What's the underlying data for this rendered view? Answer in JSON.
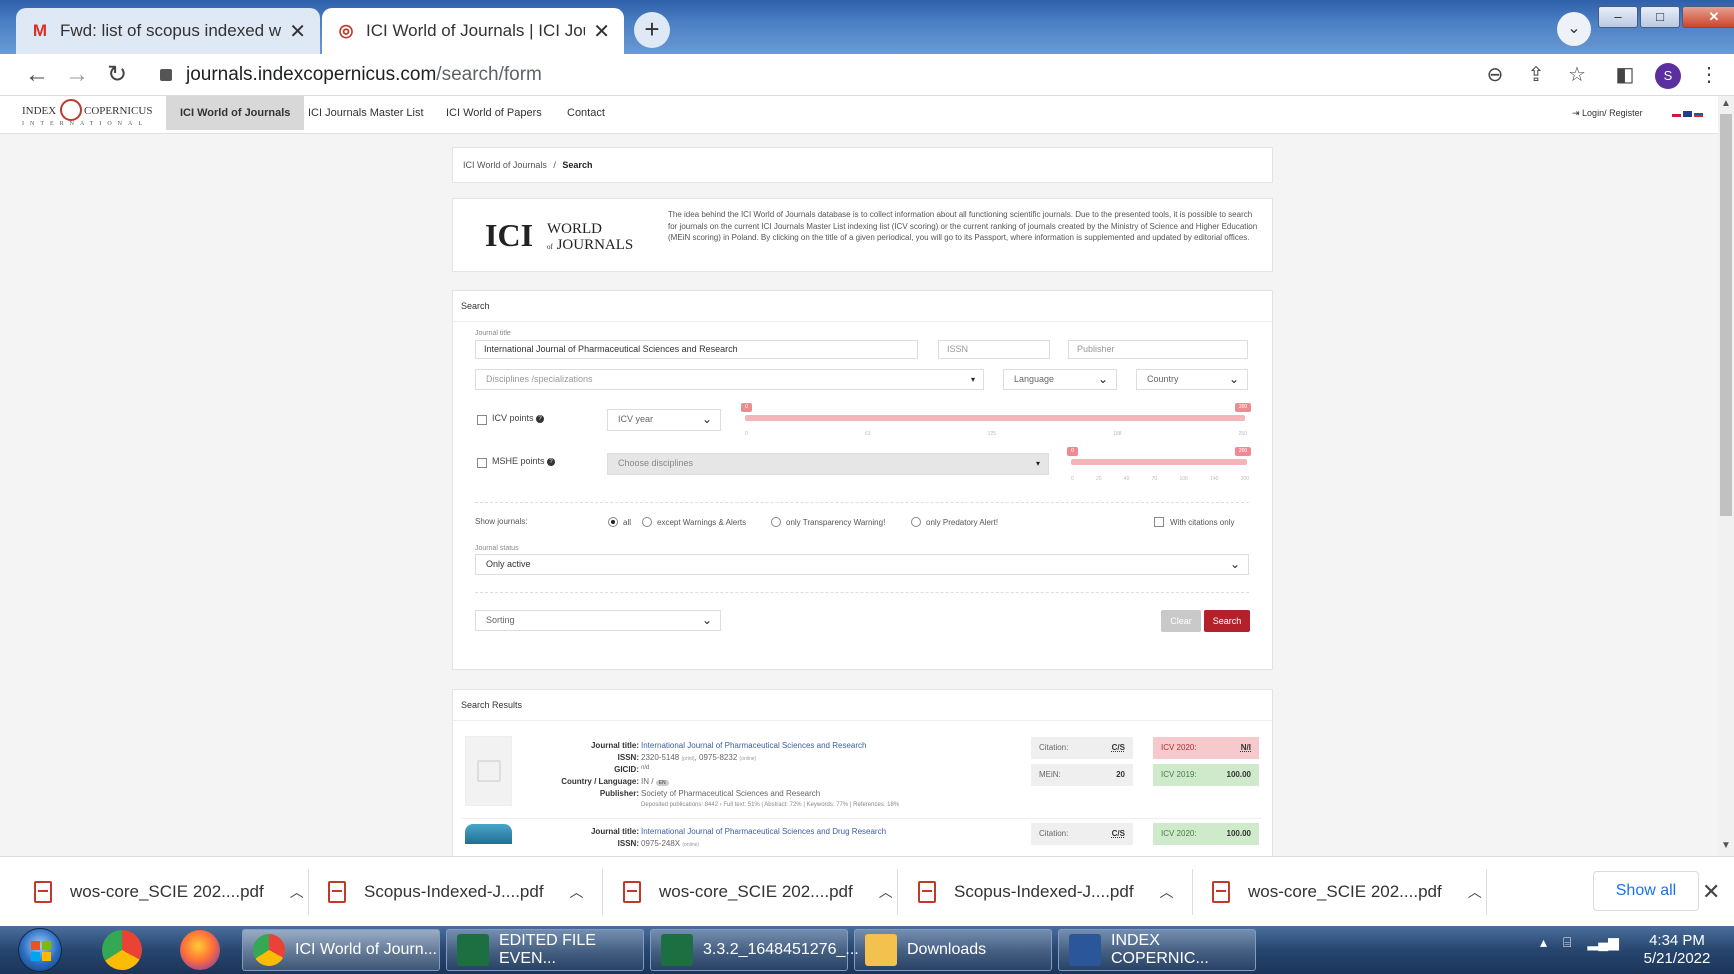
{
  "browser": {
    "tabs": [
      {
        "title": "Fwd: list of scopus indexed wos a",
        "icon": "gmail-icon",
        "active": false
      },
      {
        "title": "ICI World of Journals | ICI Journal",
        "icon": "index-copernicus-icon",
        "active": true
      }
    ],
    "url_host": "journals.indexcopernicus.com",
    "url_path": "/search/form",
    "profile_initial": "S"
  },
  "site": {
    "logo_text_left": "INDEX",
    "logo_text_right": "COPERNICUS",
    "logo_sub": "INTERNATIONAL",
    "nav": [
      "ICI World of Journals",
      "ICI Journals Master List",
      "ICI World of Papers",
      "Contact"
    ],
    "login": "Login/ Register"
  },
  "breadcrumb": {
    "parent": "ICI World of Journals",
    "separator": "/",
    "current": "Search"
  },
  "intro": {
    "logo_ici": "ICI",
    "logo_world": "WORLD",
    "logo_of": "of",
    "logo_journals": "JOURNALS",
    "text": "The idea behind the ICI World of Journals database is to collect information about all functioning scientific journals. Due to the presented tools, it is possible to search for journals on the current ICI Journals Master List indexing list (ICV scoring) or the current ranking of journals created by the Ministry of Science and Higher Education (MEiN scoring) in Poland. By clicking on the title of a given periodical, you will go to its Passport, where information is supplemented and updated by editorial offices."
  },
  "search": {
    "section_title": "Search",
    "journal_title_label": "Journal title",
    "journal_title_value": "International Journal of Pharmaceutical Sciences and Research",
    "issn_placeholder": "ISSN",
    "publisher_placeholder": "Publisher",
    "disciplines_placeholder": "Disciplines /specializations",
    "language_label": "Language",
    "country_label": "Country",
    "icv_points_label": "ICV points",
    "icv_year_label": "ICV year",
    "icv_min": "0",
    "icv_max": "200",
    "icv_ticks": [
      "0",
      "63",
      "125",
      "188",
      "250"
    ],
    "mshe_points_label": "MSHE points",
    "choose_disciplines_placeholder": "Choose disciplines",
    "mshe_min": "0",
    "mshe_max": "200",
    "mshe_ticks": [
      "0",
      "20",
      "40",
      "70",
      "100",
      "140",
      "200"
    ],
    "show_journals_label": "Show journals:",
    "radio_options": [
      "all",
      "except Warnings & Alerts",
      "only Transparency Warning!",
      "only Predatory Alert!"
    ],
    "with_citations_label": "With citations only",
    "journal_status_label": "Journal status",
    "journal_status_value": "Only active",
    "sorting_label": "Sorting",
    "clear_label": "Clear",
    "search_label": "Search"
  },
  "results": {
    "section_title": "Search Results",
    "keys": {
      "title": "Journal title:",
      "issn": "ISSN:",
      "gicid": "GICID:",
      "country_lang": "Country / Language:",
      "publisher": "Publisher:"
    },
    "items": [
      {
        "title": "International Journal of Pharmaceutical Sciences and Research",
        "issn_print": "2320-5148",
        "issn_print_tag": "(print)",
        "issn_online": "0975-8232",
        "issn_online_tag": "(online)",
        "gicid": "n/d",
        "country": "IN /",
        "language": "EN",
        "publisher": "Society of Pharmaceutical Sciences and Research",
        "deposited": "Deposited publications: 8442 › Full text: 51% | Abstract: 72% | Keywords: 77% | References: 18%",
        "citation_label": "Citation:",
        "citation_value": "C/S",
        "icv2020_label": "ICV 2020:",
        "icv2020_value": "N/I",
        "mein_label": "MEiN:",
        "mein_value": "20",
        "icv2019_label": "ICV 2019:",
        "icv2019_value": "100.00"
      },
      {
        "title": "International Journal of Pharmaceutical Sciences and Drug Research",
        "issn_print": "0975-248X",
        "issn_print_tag": "(online)",
        "citation_label": "Citation:",
        "citation_value": "C/S",
        "icv2020_label": "ICV 2020:",
        "icv2020_value": "100.00"
      }
    ]
  },
  "downloads": {
    "items": [
      "wos-core_SCIE 202....pdf",
      "Scopus-Indexed-J....pdf",
      "wos-core_SCIE 202....pdf",
      "Scopus-Indexed-J....pdf",
      "wos-core_SCIE 202....pdf"
    ],
    "show_all": "Show all"
  },
  "taskbar": {
    "items": [
      "ICI World of Journ...",
      "EDITED FILE EVEN...",
      "3.3.2_1648451276_...",
      "Downloads",
      "INDEX COPERNIC..."
    ],
    "time": "4:34 PM",
    "date": "5/21/2022"
  }
}
